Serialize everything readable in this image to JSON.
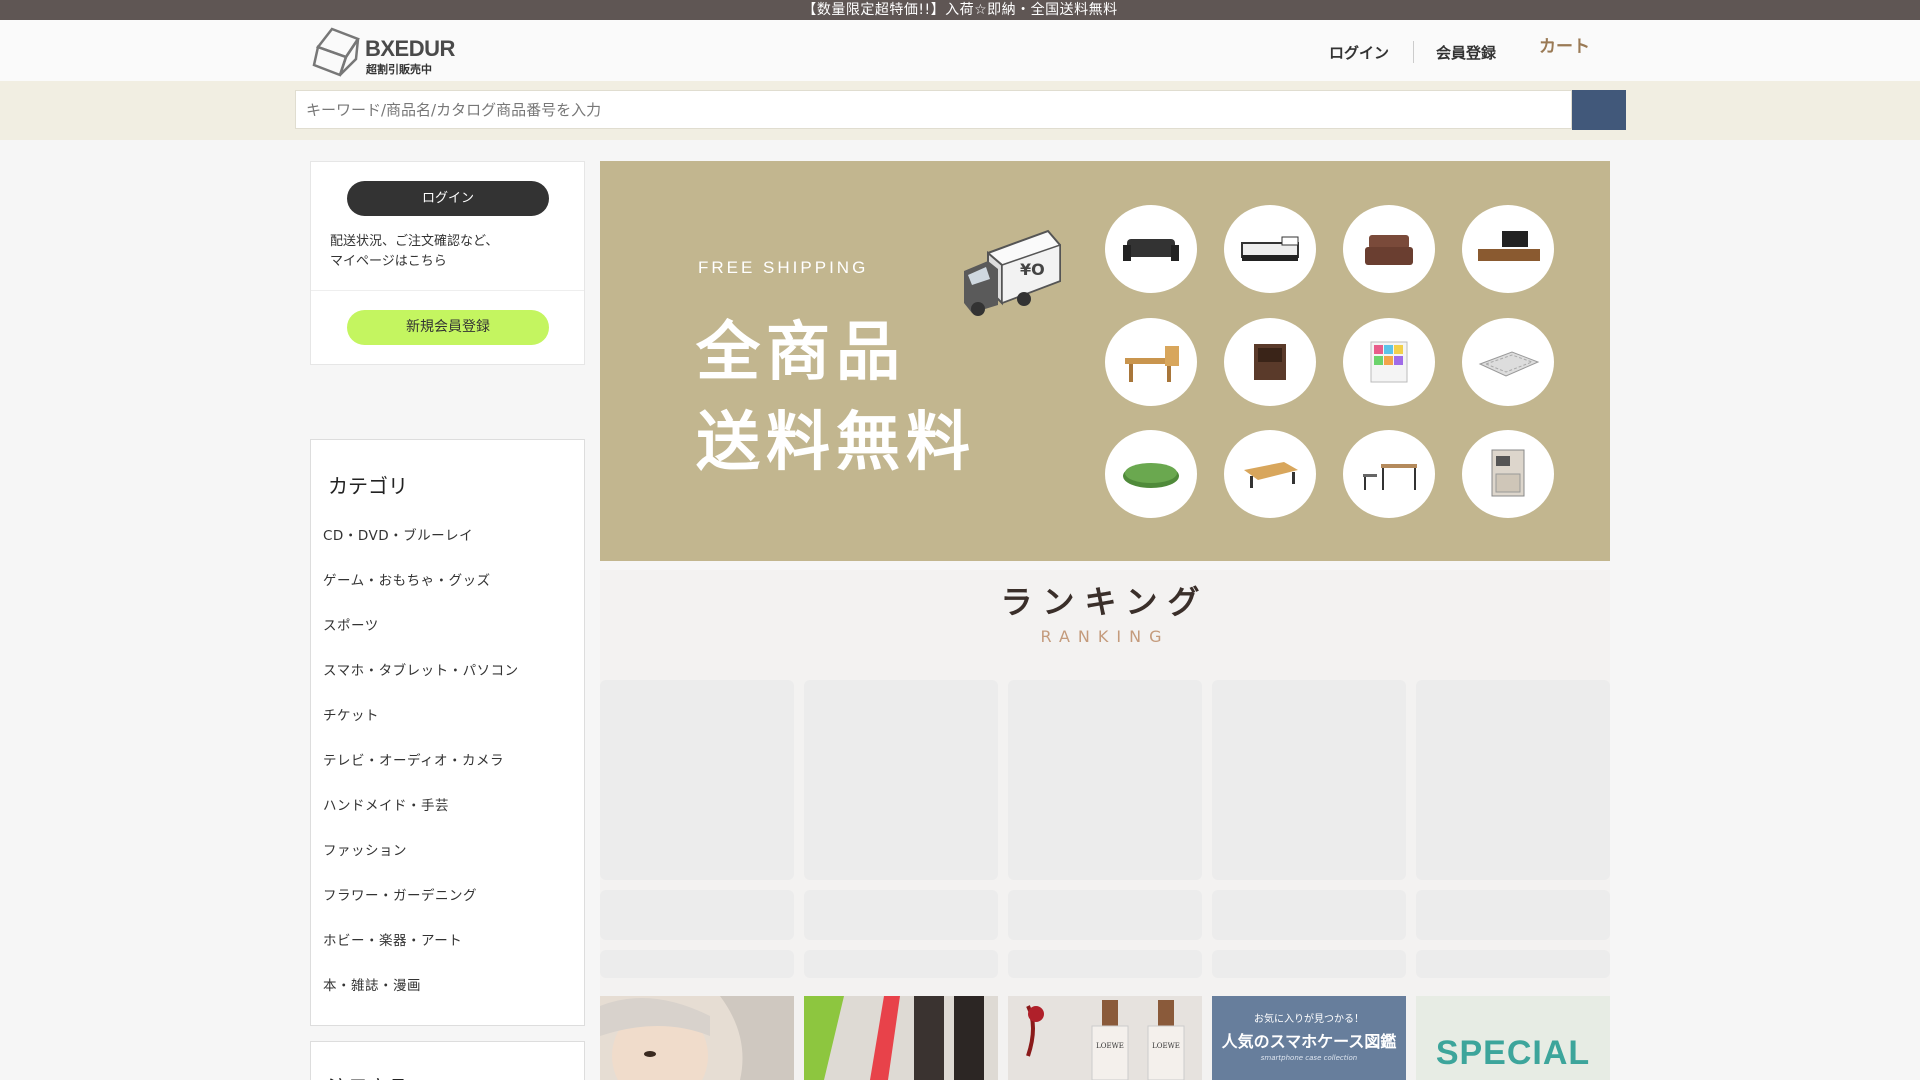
{
  "announcement": "【数量限定超特価!!】入荷☆即納・全国送料無料",
  "header": {
    "logo_text": "BXEDUR",
    "logo_sub": "超割引販売中",
    "login": "ログイン",
    "register": "会員登録",
    "cart": "カート"
  },
  "search": {
    "placeholder": "キーワード/商品名/カタログ商品番号を入力"
  },
  "member": {
    "login_button": "ログイン",
    "memo_line1": "配送状況、ご注文確認など、",
    "memo_line2": "マイページはこちら",
    "register_button": "新規会員登録"
  },
  "categories": {
    "title": "カテゴリ",
    "items": [
      "CD・DVD・ブルーレイ",
      "ゲーム・おもちゃ・グッズ",
      "スポーツ",
      "スマホ・タブレット・パソコン",
      "チケット",
      "テレビ・オーディオ・カメラ",
      "ハンドメイド・手芸",
      "ファッション",
      "フラワー・ガーデニング",
      "ホビー・楽器・アート",
      "本・雑誌・漫画"
    ]
  },
  "featured": {
    "title": "注目商品"
  },
  "banner": {
    "free_shipping": "FREE SHIPPING",
    "line1": "全商品",
    "line2": "送料無料",
    "truck_mark": "¥O",
    "background_color": "#c2b68f",
    "products": [
      "sofa-icon",
      "bed-icon",
      "cushion-icon",
      "tv-stand-icon",
      "dining-set-icon",
      "cabinet-icon",
      "storage-rack-icon",
      "rug-icon",
      "green-mat-icon",
      "low-table-icon",
      "desk-chair-icon",
      "kitchen-cabinet-icon"
    ]
  },
  "ranking": {
    "title": "ランキング",
    "subtitle": "RANKING"
  },
  "promos": {
    "case_top": "お気に入りが見つかる！",
    "case_title": "人気のスマホケース図鑑",
    "case_sub": "smartphone case collection",
    "special": "SPECIAL",
    "perfume_label": "LOEWE"
  },
  "colors": {
    "topbar": "#5f5654",
    "search_button": "#41587a",
    "register_button": "#c4f560",
    "cart": "#9a7a55"
  }
}
